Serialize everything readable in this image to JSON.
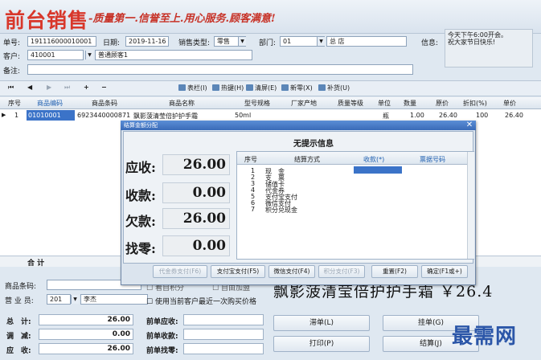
{
  "header": {
    "app_title": "前台销售",
    "slogan": "-质量第一.信誉至上.用心服务.顾客满意!",
    "doc_no_label": "单号:",
    "doc_no": "191116000010001",
    "date_label": "日期:",
    "date": "2019-11-16",
    "sale_type_label": "销售类型:",
    "sale_type": "零售",
    "dept_label": "部门:",
    "dept_code": "01",
    "dept_name": "总 店",
    "info_label": "信息:",
    "info_text": "今天下午6:00开会。\n祝大家节日快乐!",
    "customer_label": "客户:",
    "customer_code": "410001",
    "customer_name": "普通顾客1",
    "remark_label": "备注:"
  },
  "toolbar": {
    "nav": [
      "⏮",
      "◀",
      "▶",
      "⏭",
      "+",
      "−"
    ],
    "buttons": [
      "表栏(I)",
      "热键(H)",
      "清屏(E)",
      "新零(X)",
      "补货(U)"
    ]
  },
  "grid": {
    "columns": [
      "序号",
      "商品编码",
      "商品条码",
      "商品名称",
      "型号规格",
      "厂家产地",
      "质量等级",
      "单位",
      "数量",
      "原价",
      "折扣(%)",
      "单价"
    ],
    "rows": [
      {
        "no": "1",
        "code": "01010001",
        "barcode": "6923440000871",
        "name": "飘影菠清莹倍护护手霜",
        "spec": "50ml",
        "unit": "瓶",
        "qty": "1.00",
        "price": "26.40",
        "discount": "100",
        "unit_price": "26.40"
      }
    ],
    "total_label": "合 计"
  },
  "bottom": {
    "barcode_label": "商品条码:",
    "clerk_label": "营 业 员:",
    "clerk_code": "201",
    "clerk_name": "李杰",
    "check1": "看自积分",
    "check2": "自由加盟",
    "check3": "使用当前客户最近一次购买价格",
    "big_product": "飘影菠清莹倍护护手霜 ￥26.4",
    "total_label": "总　计:",
    "total_val": "26.00",
    "adjust_label": "调　减:",
    "adjust_val": "0.00",
    "receivable_label": "应　收:",
    "receivable_val": "26.00",
    "prev_receivable": "前单应收:",
    "prev_received": "前单收款:",
    "prev_change": "前单找零:",
    "btn_hold": "挂单(G)",
    "btn_pending": "滞单(L)",
    "btn_print": "打印(P)",
    "btn_checkout": "结算(J)",
    "watermark": "最需网"
  },
  "dialog": {
    "title": "结算金额分配",
    "heading": "无提示信息",
    "due_label": "应收:",
    "due_val": "26.00",
    "received_label": "收款:",
    "received_val": "0.00",
    "owed_label": "欠款:",
    "owed_val": "26.00",
    "change_label": "找零:",
    "change_val": "0.00",
    "table_headers": [
      "序号",
      "结算方式",
      "收款(*)",
      "票据号码"
    ],
    "methods": [
      {
        "no": "1",
        "name": "现　金"
      },
      {
        "no": "2",
        "name": "支　票"
      },
      {
        "no": "3",
        "name": "储值卡"
      },
      {
        "no": "4",
        "name": "代金券"
      },
      {
        "no": "5",
        "name": "支付宝支付"
      },
      {
        "no": "6",
        "name": "微信支付"
      },
      {
        "no": "7",
        "name": "积分兑现金"
      }
    ],
    "buttons": [
      "代金券支付(F6)",
      "支付宝支付(F5)",
      "微信支付(F4)",
      "积分支付(F3)",
      "重置(F2)",
      "确定(F1或+)"
    ]
  },
  "colors": {
    "brand_red": "#d8372b",
    "selection_blue": "#3b73c8",
    "title_blue": "#3a6bb8"
  }
}
